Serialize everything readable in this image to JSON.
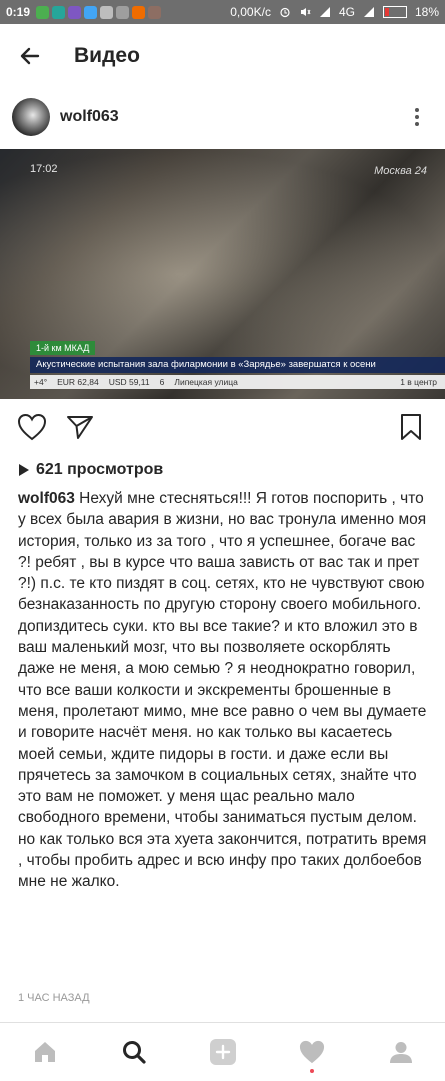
{
  "status_bar": {
    "time": "0:19",
    "speed": "0,00K/c",
    "network": "4G",
    "battery": "18%"
  },
  "app_bar": {
    "title": "Видео"
  },
  "post": {
    "username": "wolf063",
    "video": {
      "timestamp": "17:02",
      "channel_logo": "Москва 24",
      "ticker_location": "1-й км МКАД",
      "ticker_headline": "Акустические испытания зала филармонии в «Зарядье» завершатся к осени",
      "ticker_temp": "+4°",
      "ticker_eur": "EUR 62,84",
      "ticker_usd": "USD 59,11",
      "ticker_channel_num": "6",
      "ticker_street": "Липецкая улица",
      "ticker_traffic": "1 в центр"
    },
    "views": "621 просмотров",
    "caption_user": "wolf063",
    "caption_text": "Нехуй мне стесняться!!! Я готов поспорить , что у всех была авария в жизни, но вас тронула именно моя история, только из за того , что я успешнее, богаче вас ?! ребят , вы в курсе что ваша зависть от вас так и прет ?!) п.с. те кто пиздят в соц. сетях, кто не чувствуют свою безнаказанность по другую сторону своего мобильного. допиздитесь суки. кто вы все такие? и кто вложил это в ваш маленький мозг, что вы позволяете оскорблять даже не меня, а мою семью ? я неоднократно говорил, что все ваши колкости и экскременты брошенные в меня, пролетают мимо, мне все равно о чем вы думаете и говорите насчёт меня. но как только вы касаетесь моей семьи, ждите пидоры в гости. и даже если вы прячетесь за замочком в социальных сетях, знайте что это вам не поможет. у меня щас реально мало свободного времени, чтобы заниматься пустым делом. но как только вся эта хуета закончится, потратить время , чтобы пробить адрес и всю инфу про таких долбоебов мне не жалко.",
    "time_ago": "1 ЧАС НАЗАД"
  },
  "colors": {
    "text": "#262626",
    "secondary": "#999999",
    "status_bar": "#6e6e6e",
    "notification_dot": "#ed4956"
  },
  "icons": {
    "back": "arrow-left-icon",
    "more": "more-vertical-icon",
    "like": "heart-outline-icon",
    "share": "send-icon",
    "bookmark": "bookmark-icon",
    "views": "play-icon",
    "nav": [
      "home-icon",
      "search-icon",
      "add-icon",
      "heart-icon",
      "profile-icon"
    ]
  }
}
